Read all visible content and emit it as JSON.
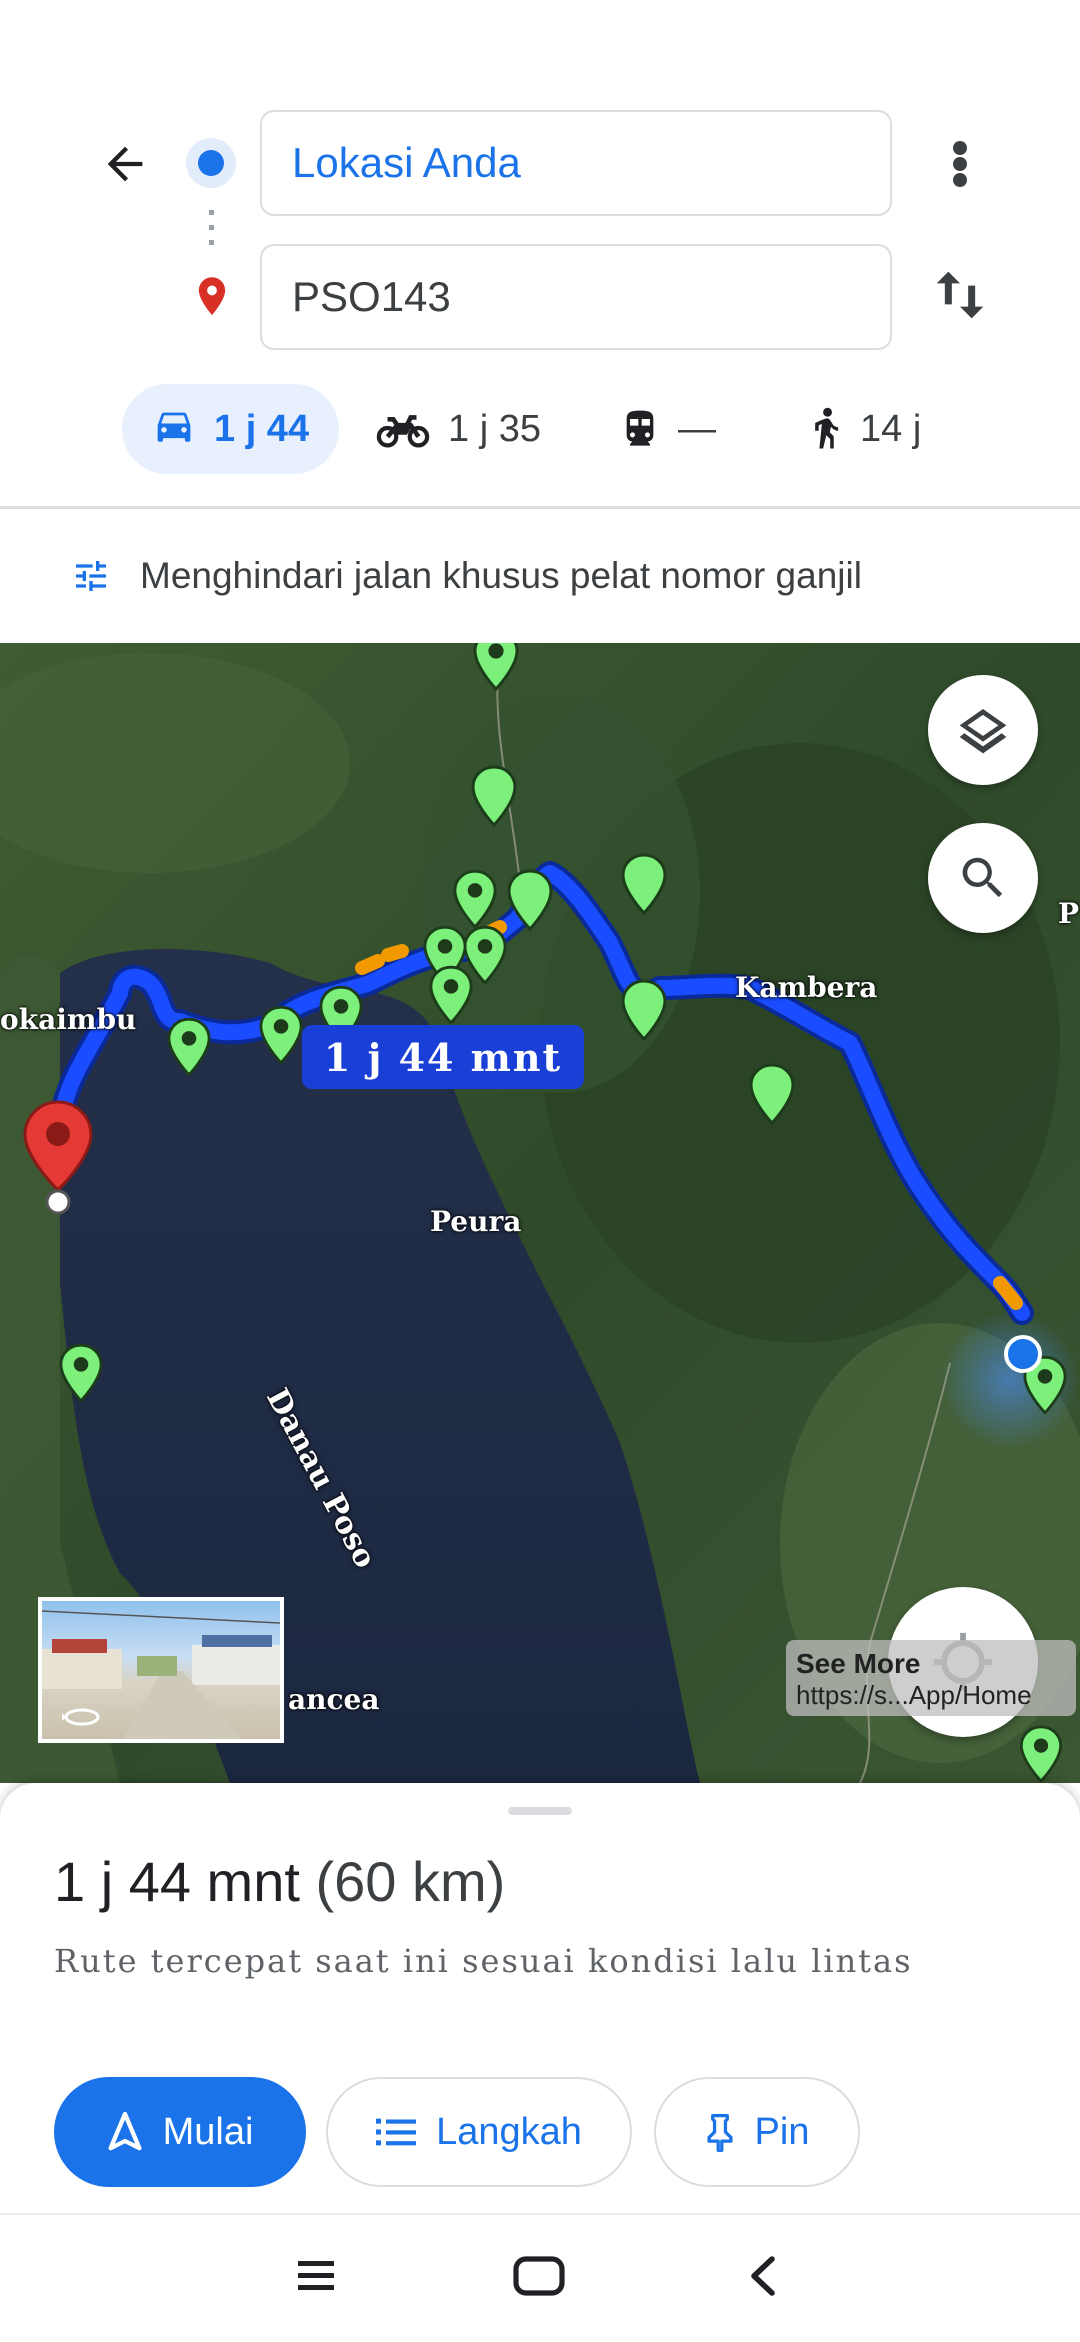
{
  "search": {
    "origin": "Lokasi Anda",
    "destination": "PSO143"
  },
  "modes": [
    {
      "icon": "car-icon",
      "label": "1 j 44",
      "selected": true
    },
    {
      "icon": "motorcycle-icon",
      "label": "1 j 35",
      "selected": false
    },
    {
      "icon": "train-icon",
      "label": "—",
      "selected": false
    },
    {
      "icon": "walk-icon",
      "label": "14 j",
      "selected": false
    }
  ],
  "options_row": {
    "icon": "tune-icon",
    "text": "Menghindari jalan khusus pelat nomor ganjil"
  },
  "map": {
    "route_bubble": "1 j 44 mnt",
    "labels": {
      "kaimbu": "okaimbu",
      "kambera": "Kambera",
      "peura": "Peura",
      "lake": "Danau Poso",
      "tentena": "ancea",
      "p_edge": "P"
    },
    "watermark": {
      "title": "See More",
      "url": "https://s...App/Home"
    },
    "colors": {
      "route": "#1a3fd6",
      "traffic": "#f29900",
      "pin_green": "#7cf07a",
      "pin_red": "#e53935",
      "current_location": "#1a73e8"
    }
  },
  "sheet": {
    "duration": "1 j 44 mnt",
    "distance": "(60 km)",
    "description": "Rute tercepat saat ini sesuai kondisi lalu lintas",
    "buttons": {
      "start": "Mulai",
      "steps": "Langkah",
      "pin": "Pin"
    }
  },
  "colors": {
    "accent": "#1a73e8",
    "selected_mode_bg": "#e8f0fe"
  }
}
